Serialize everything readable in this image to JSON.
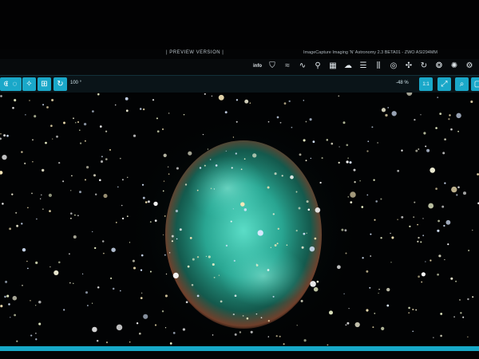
{
  "window": {
    "preview_label": "| PREVIEW VERSION |",
    "app_title": "ImageCapture Imaging 'N' Astronomy 2.3 BETA01 - ZWO ASI294MM"
  },
  "toolbar": {
    "info_label": "info",
    "icons": [
      "info-icon",
      "shield-icon",
      "graph-icon",
      "chart-icon",
      "location-pin-icon",
      "building-icon",
      "cloud-icon",
      "list-icon",
      "sliders-icon",
      "target-icon",
      "crosshair-icon",
      "refresh-icon",
      "aperture-icon",
      "palette-icon",
      "settings-icon"
    ]
  },
  "view_bar": {
    "zoom_value": "100 °",
    "scale_readout": "-48 %",
    "zoom_ratio": "1:1",
    "left_buttons": [
      "zoom-in-icon",
      "focus-icon",
      "stars-icon",
      "grid-icon",
      "rotate-icon"
    ],
    "right_buttons": [
      "expand-icon",
      "search-icon",
      "fit-icon"
    ]
  },
  "viewer": {
    "object": "M27 planetary nebula",
    "colors": {
      "nebula_core": "#3fd6c0",
      "nebula_edge": "#d77a50",
      "accent": "#1aa8c9"
    }
  }
}
